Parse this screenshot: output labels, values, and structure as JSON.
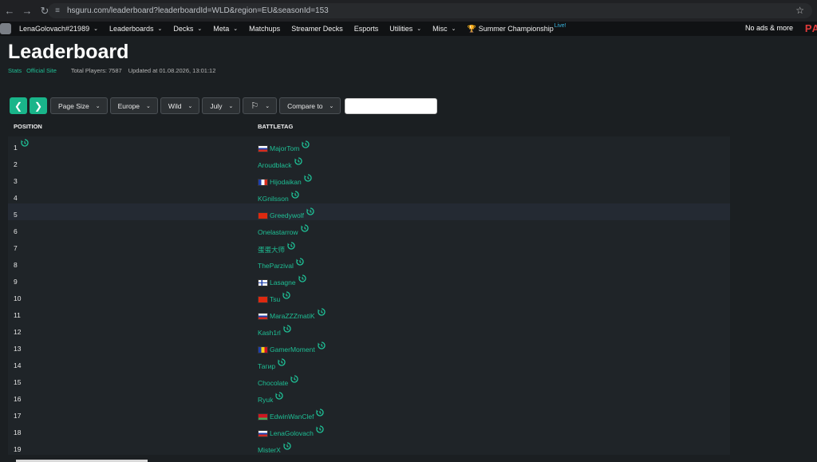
{
  "browser": {
    "url": "hsguru.com/leaderboard?leaderboardId=WLD&region=EU&seasonId=153"
  },
  "nav": {
    "items": [
      {
        "label": "LenaGolovach#21989",
        "dropdown": true
      },
      {
        "label": "Leaderboards",
        "dropdown": true
      },
      {
        "label": "Decks",
        "dropdown": true
      },
      {
        "label": "Meta",
        "dropdown": true
      },
      {
        "label": "Matchups",
        "dropdown": false
      },
      {
        "label": "Streamer Decks",
        "dropdown": false
      },
      {
        "label": "Esports",
        "dropdown": false
      },
      {
        "label": "Utilities",
        "dropdown": true
      },
      {
        "label": "Misc",
        "dropdown": true
      }
    ],
    "championship": "Summer Championship",
    "live_badge": "Live!",
    "no_ads": "No ads & more",
    "brand_fragment": "PA"
  },
  "page": {
    "title": "Leaderboard",
    "links": [
      "Stats",
      "Official Site"
    ],
    "total_players": "Total Players: 7587",
    "updated_at": "Updated at 01.08.2026, 13:01:12"
  },
  "toolbar": {
    "prev_icon": "chevron-left-icon",
    "next_icon": "chevron-right-icon",
    "page_size": "Page Size",
    "region": "Europe",
    "format": "Wild",
    "season": "July",
    "compare": "Compare to",
    "search_value": ""
  },
  "table": {
    "headers": {
      "position": "POSITION",
      "battletag": "BATTLETAG"
    },
    "highlighted_row": 5,
    "rows": [
      {
        "pos": "1",
        "tag": "MajorTom",
        "flag": "ru"
      },
      {
        "pos": "2",
        "tag": "Aroudblack",
        "flag": ""
      },
      {
        "pos": "3",
        "tag": "Hijodaikan",
        "flag": "fr"
      },
      {
        "pos": "4",
        "tag": "KGnilsson",
        "flag": ""
      },
      {
        "pos": "5",
        "tag": "Greedywolf",
        "flag": "cn"
      },
      {
        "pos": "6",
        "tag": "Onelastarrow",
        "flag": ""
      },
      {
        "pos": "7",
        "tag": "蛋蛋大师",
        "flag": ""
      },
      {
        "pos": "8",
        "tag": "TheParzival",
        "flag": ""
      },
      {
        "pos": "9",
        "tag": "Lasagne",
        "flag": "fi"
      },
      {
        "pos": "10",
        "tag": "Tsu",
        "flag": "cn"
      },
      {
        "pos": "11",
        "tag": "MaraZZZmatiK",
        "flag": "ru"
      },
      {
        "pos": "12",
        "tag": "Kash1rl",
        "flag": ""
      },
      {
        "pos": "13",
        "tag": "GamerMoment",
        "flag": "ro"
      },
      {
        "pos": "14",
        "tag": "Тагир",
        "flag": ""
      },
      {
        "pos": "15",
        "tag": "Chocolate",
        "flag": ""
      },
      {
        "pos": "16",
        "tag": "Ryuk",
        "flag": ""
      },
      {
        "pos": "17",
        "tag": "EdwinWanClef",
        "flag": "by"
      },
      {
        "pos": "18",
        "tag": "LenaGolovach",
        "flag": "ru"
      },
      {
        "pos": "19",
        "tag": "MisterX",
        "flag": ""
      }
    ]
  },
  "colors": {
    "accent": "#1fbf95",
    "background": "#1b1f22",
    "row": "#1f2428",
    "row_highlight": "#242a33"
  }
}
